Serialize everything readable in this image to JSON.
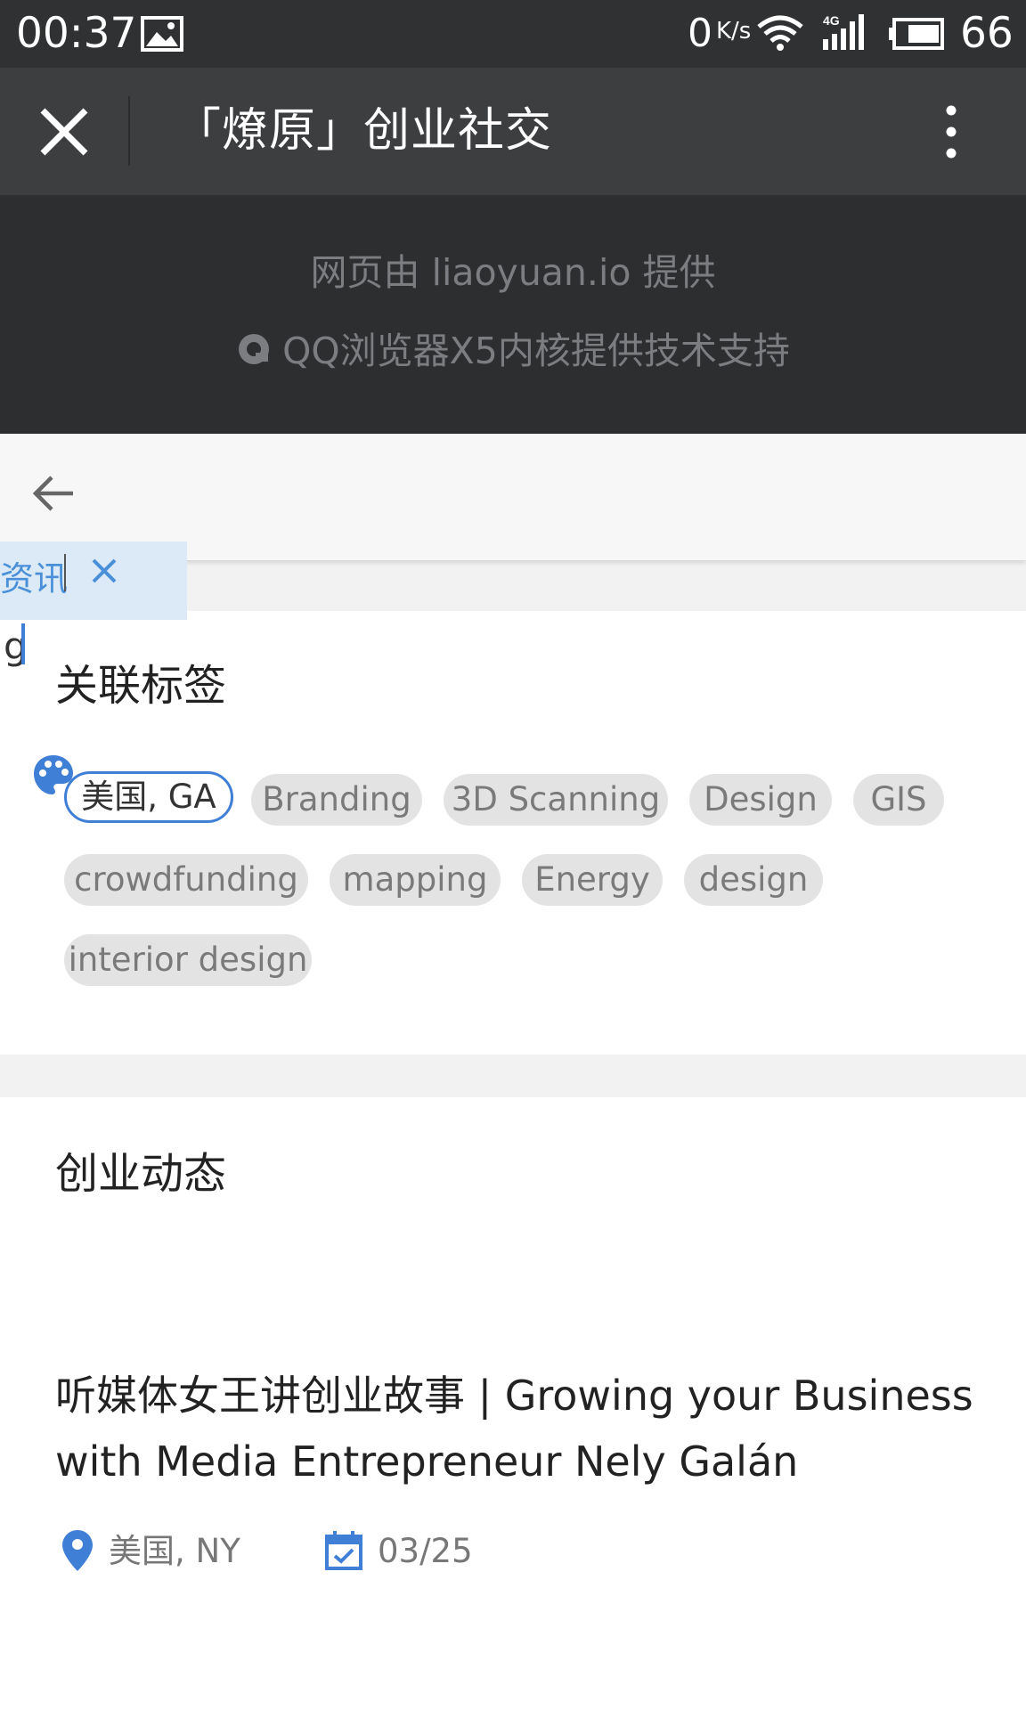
{
  "status_bar": {
    "time": "00:37",
    "net_speed": "0",
    "net_speed_unit": "K/s",
    "battery": "66",
    "icons": [
      "image-icon",
      "wifi-icon",
      "signal-4g-icon",
      "battery-icon"
    ]
  },
  "title_bar": {
    "title": "「燎原」创业社交",
    "close_icon": "close-icon",
    "more_icon": "more-vertical-icon"
  },
  "provider": {
    "line1": "网页由 liaoyuan.io 提供",
    "line2": "QQ浏览器X5内核提供技术支持"
  },
  "selection": {
    "text": "资讯"
  },
  "tags_section": {
    "stray_char": "g",
    "title": "关联标签",
    "tags": [
      {
        "label": "美国, GA",
        "active": true
      },
      {
        "label": "Branding",
        "active": false
      },
      {
        "label": "3D Scanning",
        "active": false
      },
      {
        "label": "Design",
        "active": false
      },
      {
        "label": "GIS",
        "active": false
      },
      {
        "label": "crowdfunding",
        "active": false
      },
      {
        "label": "mapping",
        "active": false
      },
      {
        "label": "Energy",
        "active": false
      },
      {
        "label": "design",
        "active": false
      },
      {
        "label": "interior design",
        "active": false
      }
    ]
  },
  "news_section": {
    "title": "创业动态",
    "item": {
      "title": "听媒体女王讲创业故事 | Growing your Business with Media Entrepreneur Nely Galán",
      "location": "美国, NY",
      "date": "03/25"
    }
  },
  "colors": {
    "status_bar_bg": "#2f3133",
    "title_bar_bg": "#3c3e40",
    "accent": "#3f7fd6"
  }
}
